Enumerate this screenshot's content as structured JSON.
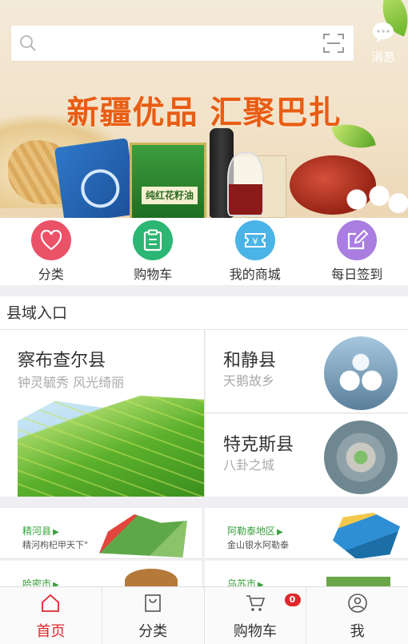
{
  "header": {
    "search_placeholder": "",
    "message_label": "消息"
  },
  "banner": {
    "headline": "新疆优品 汇聚巴扎",
    "product_label": "纯红花籽油"
  },
  "quick_nav": [
    {
      "label": "分类",
      "color": "#ea5268",
      "icon": "heart-icon"
    },
    {
      "label": "购物车",
      "color": "#2bb673",
      "icon": "clipboard-icon"
    },
    {
      "label": "我的商城",
      "color": "#4ab4e6",
      "icon": "ticket-icon"
    },
    {
      "label": "每日签到",
      "color": "#a97ee0",
      "icon": "edit-icon"
    }
  ],
  "section": {
    "title": "县域入口"
  },
  "counties": {
    "featured": {
      "name": "察布查尔县",
      "slogan": "钟灵毓秀 风光绮丽"
    },
    "items": [
      {
        "name": "和静县",
        "slogan": "天鹅故乡"
      },
      {
        "name": "特克斯县",
        "slogan": "八卦之城"
      }
    ]
  },
  "tiles": [
    {
      "name": "精河县",
      "slogan": "精河枸杞甲天下\""
    },
    {
      "name": "阿勒泰地区",
      "slogan": "金山银水阿勒泰"
    },
    {
      "name": "哈密市",
      "slogan": ""
    },
    {
      "name": "乌苏市",
      "slogan": ""
    }
  ],
  "tabbar": [
    {
      "label": "首页",
      "active": true
    },
    {
      "label": "分类",
      "active": false
    },
    {
      "label": "购物车",
      "active": false,
      "badge": "0"
    },
    {
      "label": "我",
      "active": false
    }
  ],
  "colors": {
    "accent": "#e0272c",
    "headline": "#e85d14",
    "green_link": "#3aa13d"
  }
}
